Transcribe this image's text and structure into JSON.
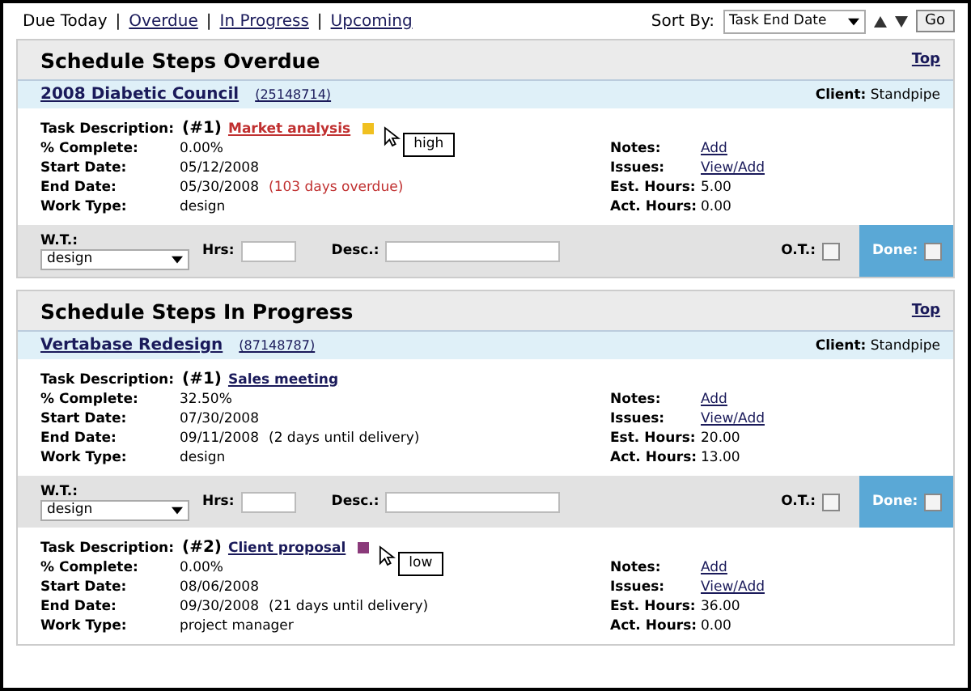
{
  "nav": {
    "items": [
      {
        "label": "Due Today",
        "selected": true
      },
      {
        "sep": "|",
        "label": "Overdue",
        "selected": false
      },
      {
        "sep": "|",
        "label": "In Progress",
        "selected": false
      },
      {
        "sep": "|",
        "label": "Upcoming",
        "selected": false
      }
    ],
    "sort_label": "Sort By:",
    "sort_value": "Task End Date",
    "go": "Go"
  },
  "sections": [
    {
      "title": "Schedule Steps Overdue",
      "top": "Top",
      "project": {
        "name": "2008 Diabetic Council",
        "code": "(25148714)",
        "client_label": "Client:",
        "client": "Standpipe"
      },
      "items": [
        {
          "kind": "task",
          "overdue": true,
          "desc_label": "Task Description:",
          "number": "(#1)",
          "name": "Market analysis",
          "color": "#f0c020",
          "tooltip": "high",
          "left": [
            {
              "label": "% Complete:",
              "value": "0.00%"
            },
            {
              "label": "Start Date:",
              "value": "05/12/2008"
            },
            {
              "label": "End Date:",
              "value": "05/30/2008",
              "note": "(103 days overdue)"
            },
            {
              "label": "Work Type:",
              "value": "design"
            }
          ],
          "right": [
            {
              "kind": "link",
              "label": "Notes:",
              "value": "Add"
            },
            {
              "kind": "link",
              "label": "Issues:",
              "value": "View/Add"
            },
            {
              "kind": "text",
              "label": "Est. Hours:",
              "value": "5.00"
            },
            {
              "kind": "text",
              "label": "Act. Hours:",
              "value": "0.00"
            }
          ]
        },
        {
          "kind": "edit",
          "wt_label": "W.T.:",
          "wt": "design",
          "hrs_label": "Hrs:",
          "desc_label": "Desc.:",
          "ot_label": "O.T.:",
          "ot": false,
          "done_label": "Done:",
          "done": false
        }
      ]
    },
    {
      "title": "Schedule Steps In Progress",
      "top": "Top",
      "project": {
        "name": "Vertabase Redesign",
        "code": "(87148787)",
        "client_label": "Client:",
        "client": "Standpipe"
      },
      "items": [
        {
          "kind": "task",
          "overdue": false,
          "desc_label": "Task Description:",
          "number": "(#1)",
          "name": "Sales meeting",
          "left": [
            {
              "label": "% Complete:",
              "value": "32.50%"
            },
            {
              "label": "Start Date:",
              "value": "07/30/2008"
            },
            {
              "label": "End Date:",
              "value": "09/11/2008",
              "note": "(2 days until delivery)"
            },
            {
              "label": "Work Type:",
              "value": "design"
            }
          ],
          "right": [
            {
              "kind": "link",
              "label": "Notes:",
              "value": "Add"
            },
            {
              "kind": "link",
              "label": "Issues:",
              "value": "View/Add"
            },
            {
              "kind": "text",
              "label": "Est. Hours:",
              "value": "20.00"
            },
            {
              "kind": "text",
              "label": "Act. Hours:",
              "value": "13.00"
            }
          ]
        },
        {
          "kind": "edit",
          "wt_label": "W.T.:",
          "wt": "design",
          "hrs_label": "Hrs:",
          "desc_label": "Desc.:",
          "ot_label": "O.T.:",
          "ot": false,
          "done_label": "Done:",
          "done": false
        },
        {
          "kind": "task",
          "overdue": false,
          "desc_label": "Task Description:",
          "number": "(#2)",
          "name": "Client proposal",
          "color": "#8a3a7a",
          "tooltip": "low",
          "left": [
            {
              "label": "% Complete:",
              "value": "0.00%"
            },
            {
              "label": "Start Date:",
              "value": "08/06/2008"
            },
            {
              "label": "End Date:",
              "value": "09/30/2008",
              "note": "(21 days until delivery)"
            },
            {
              "label": "Work Type:",
              "value": "project manager"
            }
          ],
          "right": [
            {
              "kind": "link",
              "label": "Notes:",
              "value": "Add"
            },
            {
              "kind": "link",
              "label": "Issues:",
              "value": "View/Add"
            },
            {
              "kind": "text",
              "label": "Est. Hours:",
              "value": "36.00"
            },
            {
              "kind": "text",
              "label": "Act. Hours:",
              "value": "0.00"
            }
          ]
        }
      ]
    }
  ]
}
